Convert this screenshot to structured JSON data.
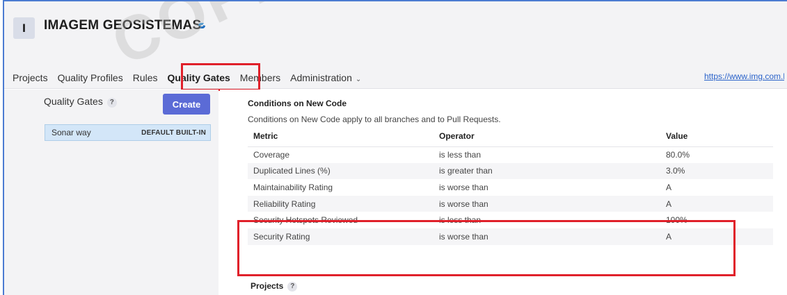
{
  "org": {
    "avatar_letter": "I",
    "name": "IMAGEM GEOSISTEMAS"
  },
  "nav": {
    "items": [
      {
        "label": "Projects"
      },
      {
        "label": "Quality Profiles"
      },
      {
        "label": "Rules"
      },
      {
        "label": "Quality Gates"
      },
      {
        "label": "Members"
      },
      {
        "label": "Administration"
      }
    ],
    "external_link": "https://www.img.com.b"
  },
  "sidebar": {
    "title": "Quality Gates",
    "help": "?",
    "create_label": "Create",
    "gates": [
      {
        "name": "Sonar way",
        "badges": "DEFAULT BUILT-IN"
      }
    ]
  },
  "conditions": {
    "title": "Conditions on New Code",
    "description": "Conditions on New Code apply to all branches and to Pull Requests.",
    "columns": [
      "Metric",
      "Operator",
      "Value"
    ],
    "rows": [
      {
        "metric": "Coverage",
        "operator": "is less than",
        "value": "80.0%"
      },
      {
        "metric": "Duplicated Lines (%)",
        "operator": "is greater than",
        "value": "3.0%"
      },
      {
        "metric": "Maintainability Rating",
        "operator": "is worse than",
        "value": "A"
      },
      {
        "metric": "Reliability Rating",
        "operator": "is worse than",
        "value": "A"
      },
      {
        "metric": "Security Hotspots Reviewed",
        "operator": "is less than",
        "value": "100%"
      },
      {
        "metric": "Security Rating",
        "operator": "is worse than",
        "value": "A"
      }
    ]
  },
  "projects": {
    "title": "Projects",
    "help": "?"
  },
  "watermark": "COPIA",
  "colors": {
    "accent": "#5b6bd6",
    "highlight": "#e0202a",
    "selected_row": "#d3e6f8",
    "link": "#2a62c9"
  }
}
